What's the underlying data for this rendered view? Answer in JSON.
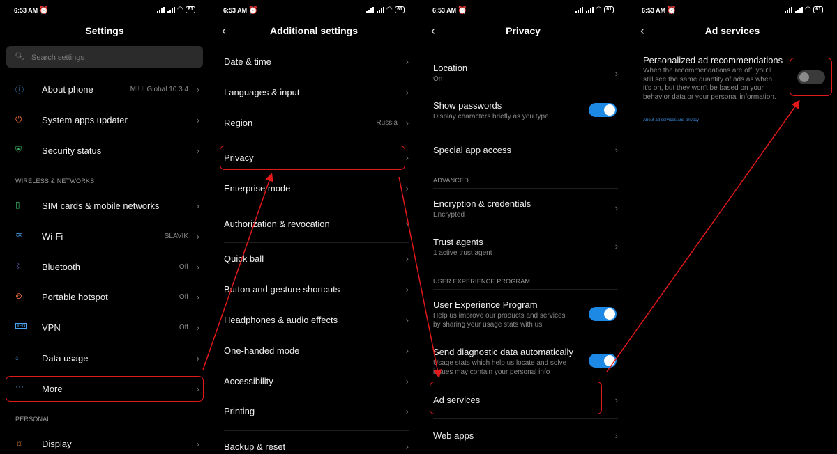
{
  "statusbar": {
    "time": "6:53 AM",
    "battery": "61"
  },
  "panel1": {
    "title": "Settings",
    "search_placeholder": "Search settings",
    "items": [
      {
        "label": "About phone",
        "value": "MIUI Global 10.3.4"
      },
      {
        "label": "System apps updater",
        "value": ""
      },
      {
        "label": "Security status",
        "value": ""
      }
    ],
    "section_wireless": "WIRELESS & NETWORKS",
    "wireless": [
      {
        "label": "SIM cards & mobile networks",
        "value": ""
      },
      {
        "label": "Wi-Fi",
        "value": "SLAVIK"
      },
      {
        "label": "Bluetooth",
        "value": "Off"
      },
      {
        "label": "Portable hotspot",
        "value": "Off"
      },
      {
        "label": "VPN",
        "value": "Off"
      },
      {
        "label": "Data usage",
        "value": ""
      },
      {
        "label": "More",
        "value": ""
      }
    ],
    "section_personal": "PERSONAL",
    "personal": [
      {
        "label": "Display",
        "value": ""
      }
    ]
  },
  "panel2": {
    "title": "Additional settings",
    "items": [
      {
        "label": "Date & time",
        "value": ""
      },
      {
        "label": "Languages & input",
        "value": ""
      },
      {
        "label": "Region",
        "value": "Russia"
      },
      {
        "label": "Privacy",
        "value": ""
      },
      {
        "label": "Enterprise mode",
        "value": ""
      },
      {
        "label": "Authorization & revocation",
        "value": ""
      },
      {
        "label": "Quick ball",
        "value": ""
      },
      {
        "label": "Button and gesture shortcuts",
        "value": ""
      },
      {
        "label": "Headphones & audio effects",
        "value": ""
      },
      {
        "label": "One-handed mode",
        "value": ""
      },
      {
        "label": "Accessibility",
        "value": ""
      },
      {
        "label": "Printing",
        "value": ""
      },
      {
        "label": "Backup & reset",
        "value": ""
      }
    ]
  },
  "panel3": {
    "title": "Privacy",
    "location": {
      "label": "Location",
      "sub": "On"
    },
    "show_passwords": {
      "label": "Show passwords",
      "sub": "Display characters briefly as you type",
      "on": true
    },
    "special_access": {
      "label": "Special app access"
    },
    "section_advanced": "ADVANCED",
    "encryption": {
      "label": "Encryption & credentials",
      "sub": "Encrypted"
    },
    "trust_agents": {
      "label": "Trust agents",
      "sub": "1 active trust agent"
    },
    "section_uxp": "USER EXPERIENCE PROGRAM",
    "uxp": {
      "label": "User Experience Program",
      "sub1": "Help us improve our products and services",
      "sub2": "by sharing your usage stats with us",
      "on": true
    },
    "diagnostic": {
      "label": "Send diagnostic data automatically",
      "sub1": "Usage stats which help us locate and solve",
      "sub2": "issues may contain your personal info",
      "on": true
    },
    "ad_services": {
      "label": "Ad services"
    },
    "web_apps": {
      "label": "Web apps"
    }
  },
  "panel4": {
    "title": "Ad services",
    "personalized": {
      "label": "Personalized ad recommendations",
      "desc": [
        "When the recommendations are off, you'll",
        "still see the same quantity of ads as when",
        "it's on, but they won't be based on your",
        "behavior data or your personal information."
      ],
      "on": false
    },
    "link": "About ad services and privacy"
  },
  "colors": {
    "highlight": "#e1191b",
    "toggle_on": "#1e88e5",
    "link": "#3b8de0"
  },
  "icons": [
    "info-icon",
    "update-icon",
    "shield-icon",
    "sim-icon",
    "wifi-icon",
    "bluetooth-icon",
    "hotspot-icon",
    "vpn-icon",
    "data-drop-icon",
    "more-dots-icon",
    "display-sun-icon",
    "chevron-right-icon",
    "back-chevron-icon",
    "search-icon",
    "alarm-icon",
    "signal-icon",
    "battery-icon"
  ]
}
